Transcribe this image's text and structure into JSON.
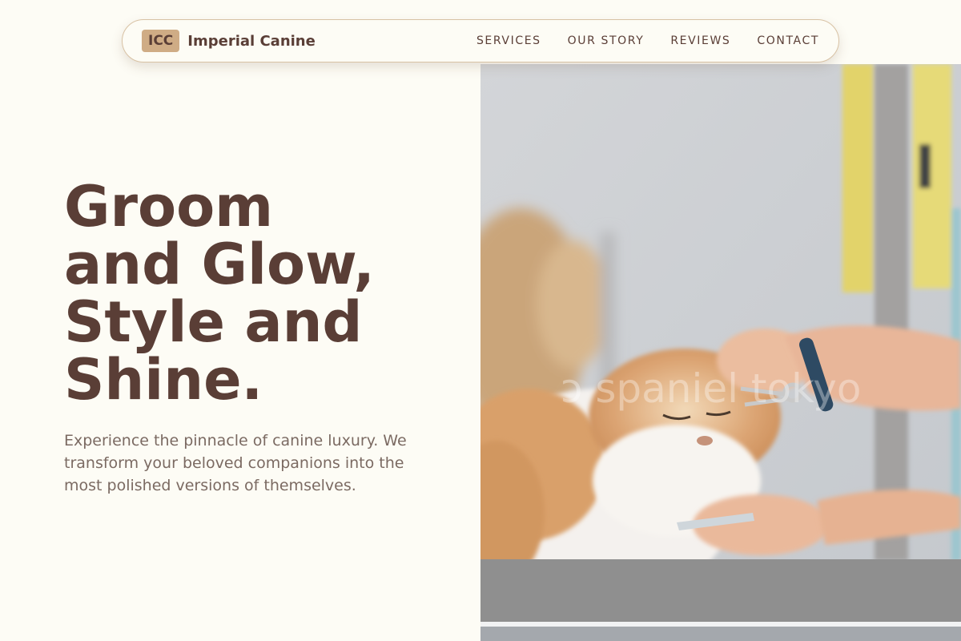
{
  "nav": {
    "brand_badge": "ICC",
    "brand_name": "Imperial Canine",
    "links": [
      "SERVICES",
      "OUR STORY",
      "REVIEWS",
      "CONTACT"
    ]
  },
  "hero": {
    "title_lines": [
      "Groom",
      "and Glow,",
      "Style and",
      "Shine."
    ],
    "subtitle": "Experience the pinnacle of canine luxury. We transform your beloved companions into the most polished versions of themselves."
  },
  "photo": {
    "watermark": "ɔ spaniel tokyo"
  },
  "colors": {
    "background": "#fdfcf5",
    "brand_brown": "#5a3e36",
    "accent_tan": "#cfac85",
    "nav_border": "#d8c2a4",
    "body_text": "#7b6a62"
  }
}
